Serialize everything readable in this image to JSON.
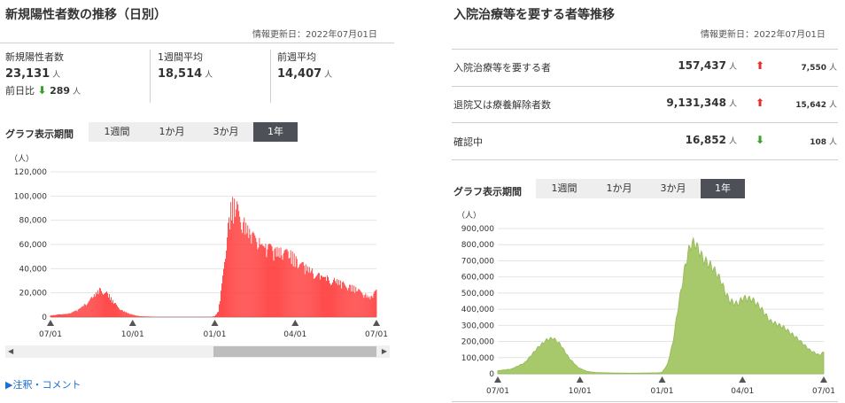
{
  "left": {
    "title": "新規陽性者数の推移（日別）",
    "updated": "情報更新日：2022年07月01日",
    "stats": [
      {
        "label": "新規陽性者数",
        "value": "23,131",
        "unit": "人"
      },
      {
        "label": "1週間平均",
        "value": "18,514",
        "unit": "人"
      },
      {
        "label": "前週平均",
        "value": "14,407",
        "unit": "人"
      }
    ],
    "prev_day": {
      "label": "前日比",
      "arrow": "⬇",
      "value": "289",
      "unit": "人"
    },
    "period_label": "グラフ表示期間",
    "tabs": [
      "1週間",
      "1か月",
      "3か月",
      "1年"
    ],
    "active_tab": 3,
    "note_link": "▶注釈・コメント",
    "scroll_left_glyph": "◀",
    "scroll_right_glyph": "▶"
  },
  "right": {
    "title": "入院治療等を要する者等推移",
    "updated": "情報更新日：2022年07月01日",
    "rows": [
      {
        "label": "入院治療等を要する者",
        "value": "157,437",
        "unit": "人",
        "arrow": "⬆",
        "dir": "up",
        "change": "7,550",
        "change_unit": "人"
      },
      {
        "label": "退院又は療養解除者数",
        "value": "9,131,348",
        "unit": "人",
        "arrow": "⬆",
        "dir": "up",
        "change": "15,642",
        "change_unit": "人"
      },
      {
        "label": "確認中",
        "value": "16,852",
        "unit": "人",
        "arrow": "⬇",
        "dir": "down",
        "change": "108",
        "change_unit": "人"
      }
    ],
    "period_label": "グラフ表示期間",
    "tabs": [
      "1週間",
      "1か月",
      "3か月",
      "1年"
    ],
    "active_tab": 3
  },
  "colors": {
    "bar_red": "#ff3b3b",
    "area_green": "#a8c96b",
    "active_tab": "#4d5157"
  },
  "chart_data": [
    {
      "type": "bar",
      "unit_label": "（人）",
      "ylim": [
        0,
        120000
      ],
      "yticks": [
        0,
        20000,
        40000,
        60000,
        80000,
        100000,
        120000
      ],
      "ytick_labels": [
        "0",
        "20,000",
        "40,000",
        "60,000",
        "80,000",
        "100,000",
        "120,000"
      ],
      "xtick_labels": [
        "07/01",
        "10/01",
        "01/01",
        "04/01",
        "07/01"
      ],
      "xtick_days": [
        0,
        92,
        184,
        274,
        365
      ],
      "grid": true,
      "series": [
        {
          "days": [
            0,
            20,
            30,
            40,
            50,
            55,
            60,
            66,
            70,
            80,
            90,
            100,
            120,
            150,
            180,
            184,
            188,
            192,
            195,
            200,
            203,
            210,
            215,
            225,
            240,
            260,
            270,
            280,
            300,
            320,
            340,
            350,
            358,
            365
          ],
          "values": [
            1500,
            3000,
            6000,
            12000,
            20000,
            24500,
            23500,
            19000,
            14000,
            6000,
            2500,
            800,
            200,
            150,
            200,
            900,
            5000,
            28000,
            55000,
            85000,
            100000,
            95000,
            85000,
            72000,
            62000,
            57000,
            55000,
            47000,
            37000,
            32000,
            26000,
            21000,
            17000,
            23000
          ]
        }
      ]
    },
    {
      "type": "area",
      "unit_label": "（人）",
      "ylim": [
        0,
        900000
      ],
      "yticks": [
        0,
        100000,
        200000,
        300000,
        400000,
        500000,
        600000,
        700000,
        800000,
        900000
      ],
      "ytick_labels": [
        "0",
        "100,000",
        "200,000",
        "300,000",
        "400,000",
        "500,000",
        "600,000",
        "700,000",
        "800,000",
        "900,000"
      ],
      "xtick_labels": [
        "07/01",
        "10/01",
        "01/01",
        "04/01",
        "07/01"
      ],
      "xtick_days": [
        0,
        92,
        184,
        274,
        365
      ],
      "grid": true,
      "series": [
        {
          "days": [
            0,
            15,
            30,
            45,
            55,
            62,
            70,
            80,
            90,
            100,
            110,
            130,
            150,
            180,
            184,
            190,
            196,
            202,
            210,
            215,
            220,
            225,
            230,
            240,
            250,
            255,
            260,
            268,
            275,
            285,
            295,
            305,
            320,
            335,
            350,
            360,
            365
          ],
          "values": [
            20000,
            30000,
            70000,
            170000,
            220000,
            230000,
            190000,
            100000,
            40000,
            15000,
            8000,
            5000,
            4000,
            6000,
            10000,
            60000,
            200000,
            430000,
            700000,
            820000,
            850000,
            800000,
            740000,
            690000,
            600000,
            520000,
            470000,
            450000,
            490000,
            480000,
            420000,
            340000,
            300000,
            230000,
            150000,
            120000,
            140000
          ]
        }
      ]
    }
  ]
}
